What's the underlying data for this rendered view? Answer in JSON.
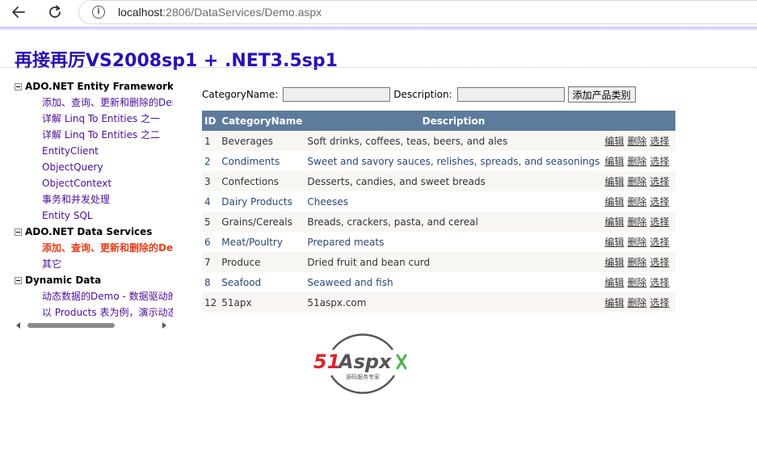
{
  "browser": {
    "url_host": "localhost",
    "url_rest": ":2806/DataServices/Demo.aspx"
  },
  "page": {
    "title": "再接再厉VS2008sp1 + .NET3.5sp1"
  },
  "tree": {
    "groups": [
      {
        "label": "ADO.NET Entity Framework",
        "items": [
          {
            "label": "添加、查询、更新和删除的Demo"
          },
          {
            "label": "详解 Linq To Entities 之一"
          },
          {
            "label": "详解 Linq To Entities 之二"
          },
          {
            "label": "EntityClient"
          },
          {
            "label": "ObjectQuery"
          },
          {
            "label": "ObjectContext"
          },
          {
            "label": "事务和并发处理"
          },
          {
            "label": "Entity SQL"
          }
        ]
      },
      {
        "label": "ADO.NET Data Services",
        "items": [
          {
            "label": "添加、查询、更新和删除的Demo"
          },
          {
            "label": "其它"
          }
        ]
      },
      {
        "label": "Dynamic Data",
        "items": [
          {
            "label": "动态数据的Demo - 数据驱动的Web应用程序"
          },
          {
            "label": "以 Products 表为例，演示动态数据"
          }
        ]
      }
    ]
  },
  "form": {
    "category_label": "CategoryName:",
    "category_value": "",
    "description_label": "Description:",
    "description_value": "",
    "add_button": "添加产品类别"
  },
  "table": {
    "headers": [
      "ID",
      "CategoryName",
      "Description"
    ],
    "commands": [
      "编辑",
      "删除",
      "选择"
    ],
    "rows": [
      {
        "id": "1",
        "name": "Beverages",
        "desc": "Soft drinks, coffees, teas, beers, and ales"
      },
      {
        "id": "2",
        "name": "Condiments",
        "desc": "Sweet and savory sauces, relishes, spreads, and seasonings"
      },
      {
        "id": "3",
        "name": "Confections",
        "desc": "Desserts, candies, and sweet breads"
      },
      {
        "id": "4",
        "name": "Dairy Products",
        "desc": "Cheeses"
      },
      {
        "id": "5",
        "name": "Grains/Cereals",
        "desc": "Breads, crackers, pasta, and cereal"
      },
      {
        "id": "6",
        "name": "Meat/Poultry",
        "desc": "Prepared meats"
      },
      {
        "id": "7",
        "name": "Produce",
        "desc": "Dried fruit and bean curd"
      },
      {
        "id": "8",
        "name": "Seafood",
        "desc": "Seaweed and fish"
      },
      {
        "id": "12",
        "name": "51apx",
        "desc": "51aspx.com"
      }
    ]
  },
  "logo": {
    "brand": "51Aspx",
    "tagline": "源码服务专家"
  }
}
